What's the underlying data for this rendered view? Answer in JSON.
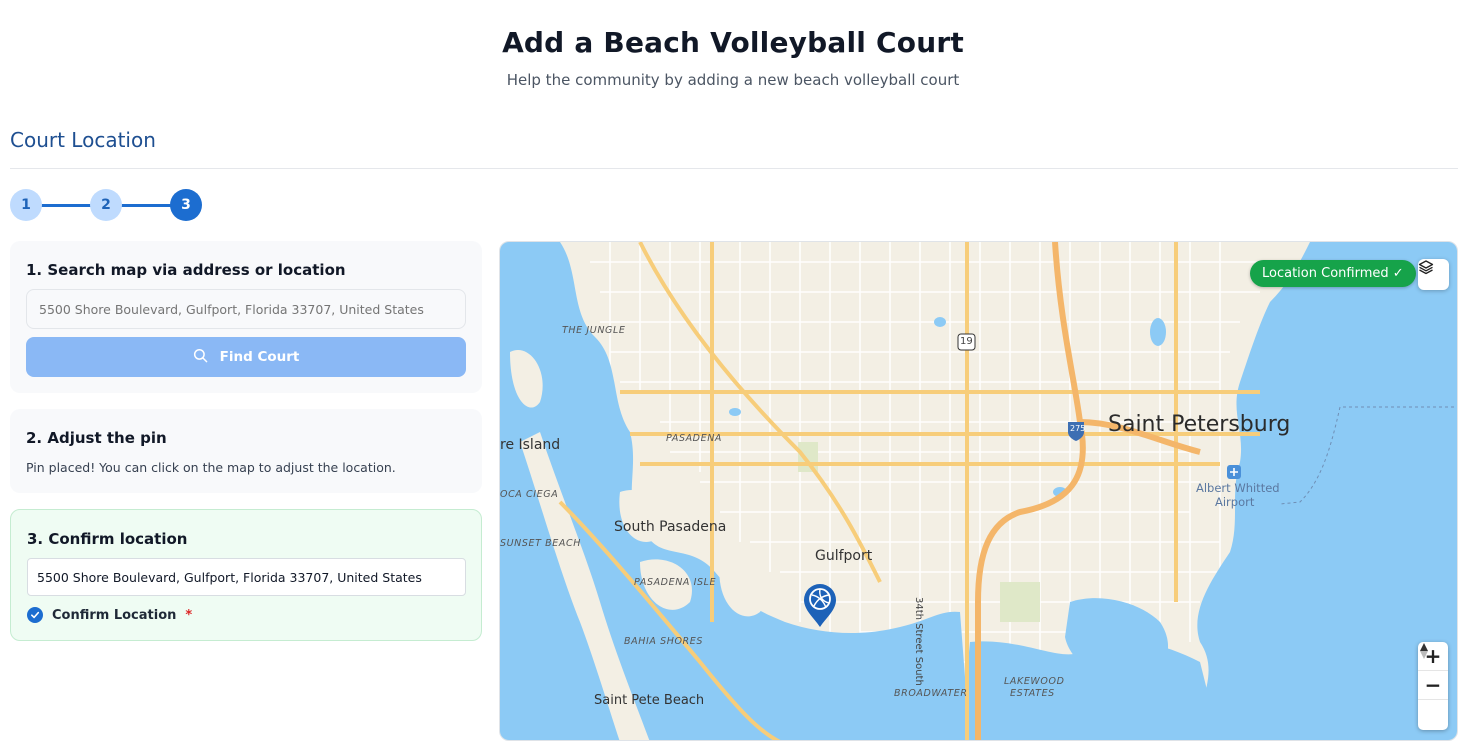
{
  "header": {
    "title": "Add a Beach Volleyball Court",
    "subtitle": "Help the community by adding a new beach volleyball court"
  },
  "section": {
    "title": "Court Location"
  },
  "stepper": {
    "steps": [
      "1",
      "2",
      "3"
    ],
    "current_step": 3
  },
  "step1": {
    "heading": "1. Search map via address or location",
    "search_placeholder": "5500 Shore Boulevard, Gulfport, Florida 33707, United States",
    "find_button_label": "Find Court",
    "search_icon": "search-icon"
  },
  "step2": {
    "heading": "2. Adjust the pin",
    "description": "Pin placed! You can click on the map to adjust the location."
  },
  "step3": {
    "heading": "3. Confirm location",
    "address_value": "5500 Shore Boulevard, Gulfport, Florida 33707, United States",
    "confirm_label": "Confirm Location",
    "required_mark": "*",
    "confirmed": true
  },
  "map": {
    "status_badge": "Location Confirmed ✓",
    "layers_icon": "layers-icon",
    "zoom_in_label": "+",
    "zoom_out_label": "−",
    "compass_icon": "compass-icon",
    "pin_icon": "volleyball-pin-icon",
    "labels": {
      "saint_petersburg": "Saint Petersburg",
      "the_jungle": "THE JUNGLE",
      "pasadena": "PASADENA",
      "treasure_island": "re Island",
      "boca_ciega": "OCA CIEGA",
      "south_pasadena": "South Pasadena",
      "sunset_beach": "SUNSET BEACH",
      "gulfport": "Gulfport",
      "pasadena_isle": "PASADENA ISLE",
      "bahia_shores": "BAHIA SHORES",
      "saint_pete_beach": "Saint Pete Beach",
      "broadwater": "BROADWATER",
      "lakewood_estates_1": "LAKEWOOD",
      "lakewood_estates_2": "ESTATES",
      "street_34th": "34th Street South",
      "airport_1": "Albert Whitted",
      "airport_2": "Airport",
      "shield_19": "19",
      "shield_275": "275"
    },
    "colors": {
      "water": "#8ccaf5",
      "land": "#f3efe4",
      "major_road": "#f7cd7a",
      "highway": "#f4b66a",
      "badge": "#16a34a"
    }
  }
}
